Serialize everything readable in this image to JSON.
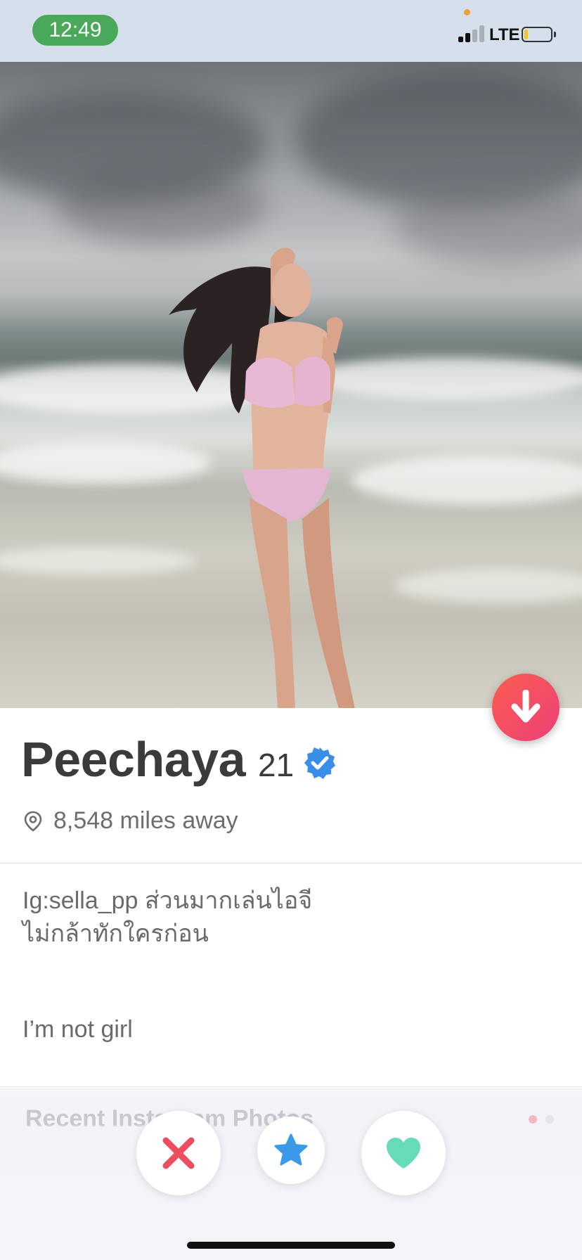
{
  "status_bar": {
    "time": "12:49",
    "network": "LTE",
    "signal_bars_active": 2,
    "signal_bars_total": 4,
    "battery_level_fraction": 0.12
  },
  "profile": {
    "name": "Peechaya",
    "age": "21",
    "verified": true,
    "distance": "8,548 miles away",
    "bio_line1": "Ig:sella_pp ส่วนมากเล่นไอจี",
    "bio_line2": "ไม่กล้าทักใครก่อน",
    "bio_extra": "I’m not girl"
  },
  "instagram": {
    "section_title": "Recent Instagram Photos",
    "page_count": 2,
    "active_page": 1
  },
  "actions": {
    "nope_icon": "x-icon",
    "super_like_icon": "star-icon",
    "like_icon": "heart-icon"
  },
  "colors": {
    "accent_gradient_start": "#fb5d4d",
    "accent_gradient_end": "#ec3f7a",
    "nope": "#ec4e5f",
    "super_like": "#3b9ae8",
    "like": "#66dbb8",
    "verified": "#3b8ee8"
  }
}
